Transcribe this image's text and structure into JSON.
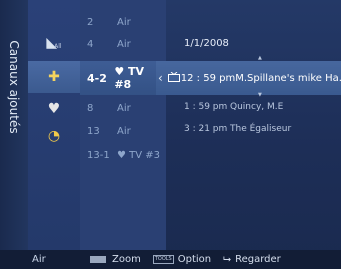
{
  "sidebar": {
    "title": "Canaux ajoutés"
  },
  "icons": [
    {
      "name": "all-channels-icon",
      "glyph": "◣",
      "sub": "All"
    },
    {
      "name": "added-channels-icon",
      "glyph": "✚"
    },
    {
      "name": "favorites-heart-icon",
      "glyph": "♥"
    },
    {
      "name": "programmed-clock-icon",
      "glyph": "◔"
    }
  ],
  "channels": {
    "above": [
      {
        "num": "2",
        "name": "Air"
      },
      {
        "num": "4",
        "name": "Air"
      }
    ],
    "selected": {
      "num": "4-2",
      "name": "♥ TV #8",
      "arrow": "‹"
    },
    "below": [
      {
        "num": "8",
        "name": "Air"
      },
      {
        "num": "13",
        "name": "Air"
      },
      {
        "num": "13-1",
        "name": "♥ TV #3"
      }
    ]
  },
  "guide": {
    "date": "1/1/2008",
    "up_arrow": "▲",
    "down_arrow": "▼",
    "selected": {
      "type_icon": "tv-icon",
      "time": "12 : 59 pm",
      "title": "M.Spillane's mike Ha..."
    },
    "items": [
      {
        "time": "1 : 59 pm",
        "title": "Quincy, M.E"
      },
      {
        "time": "3 : 21 pm",
        "title": "The Égaliseur"
      }
    ]
  },
  "footer": {
    "mode": "Air",
    "zoom_label": "Zoom",
    "tools_badge": "TOOLS",
    "option_label": "Option",
    "enter_glyph": "⮡",
    "watch_label": "Regarder"
  },
  "colors": {
    "background": "#243967",
    "highlight": "#3e5d95",
    "bottom_bar": "#121d36"
  }
}
